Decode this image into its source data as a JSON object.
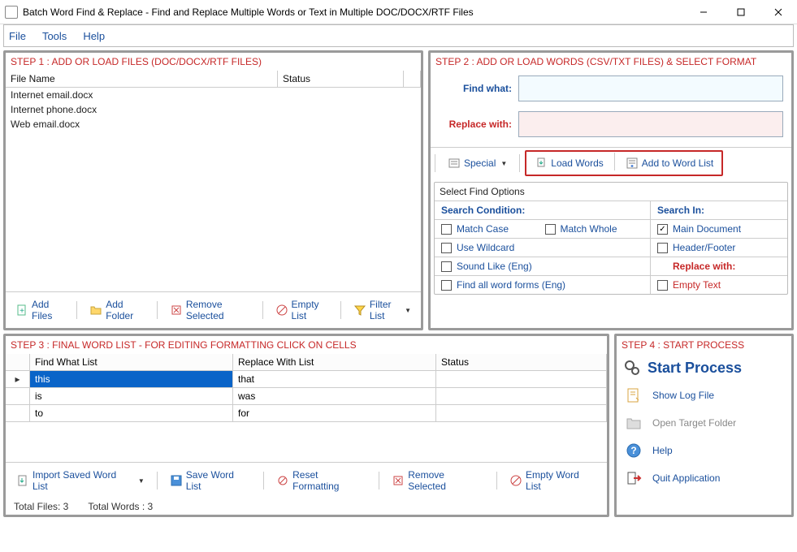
{
  "titlebar": {
    "title": "Batch Word Find & Replace - Find and Replace Multiple Words or Text  in Multiple DOC/DOCX/RTF Files"
  },
  "menu": {
    "file": "File",
    "tools": "Tools",
    "help": "Help"
  },
  "step1": {
    "title": "STEP 1 : ADD OR LOAD FILES (DOC/DOCX/RTF FILES)",
    "cols": {
      "a": "File Name",
      "b": "Status"
    },
    "rows": [
      "Internet email.docx",
      "Internet phone.docx",
      "Web email.docx"
    ],
    "toolbar": {
      "add_files": "Add Files",
      "add_folder": "Add Folder",
      "remove_selected": "Remove Selected",
      "empty_list": "Empty List",
      "filter_list": "Filter List"
    }
  },
  "step2": {
    "title": "STEP 2 : ADD OR LOAD WORDS (CSV/TXT FILES) & SELECT FORMAT",
    "find_label": "Find what:",
    "replace_label": "Replace with:",
    "find_value": "",
    "replace_value": "",
    "toolbar": {
      "special": "Special",
      "load_words": "Load Words",
      "add_to_list": "Add to Word List"
    },
    "options": {
      "title": "Select Find Options",
      "search_condition": "Search Condition:",
      "search_in": "Search In:",
      "replace_with": "Replace with:",
      "match_case": "Match Case",
      "match_whole": "Match Whole",
      "use_wildcard": "Use Wildcard",
      "sound_like": "Sound Like (Eng)",
      "all_forms": "Find all word forms (Eng)",
      "main_doc": "Main Document",
      "header_footer": "Header/Footer",
      "empty_text": "Empty Text"
    }
  },
  "step3": {
    "title": "STEP 3 : FINAL WORD LIST - FOR EDITING FORMATTING CLICK ON CELLS",
    "cols": {
      "a": "Find What List",
      "b": "Replace With List",
      "c": "Status"
    },
    "rows": [
      {
        "find": "this",
        "replace": "that"
      },
      {
        "find": "is",
        "replace": "was"
      },
      {
        "find": "to",
        "replace": "for"
      }
    ],
    "toolbar": {
      "import": "Import Saved Word List",
      "save": "Save Word List",
      "reset": "Reset Formatting",
      "remove": "Remove Selected",
      "empty": "Empty Word List"
    },
    "status": {
      "files": "Total Files: 3",
      "words": "Total Words : 3"
    }
  },
  "step4": {
    "title": "STEP 4 : START PROCESS",
    "start": "Start Process",
    "log": "Show Log File",
    "open": "Open Target Folder",
    "help": "Help",
    "quit": "Quit Application"
  }
}
